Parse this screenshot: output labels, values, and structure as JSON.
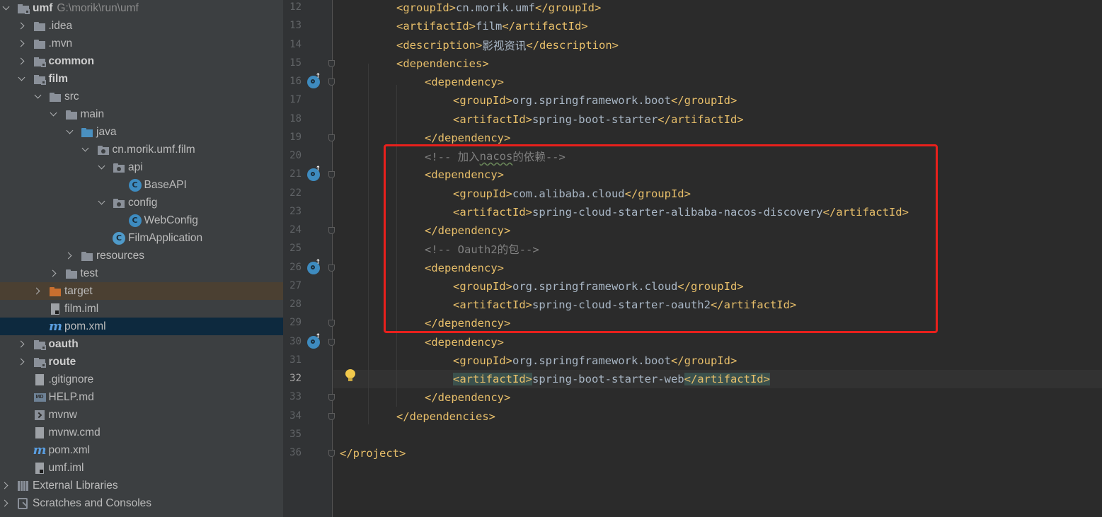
{
  "project_tree": {
    "items": [
      {
        "label": "umf",
        "path": "G:\\morik\\run\\umf",
        "depth": 0,
        "expanded": true,
        "icon": "module-folder-icon",
        "bold": true
      },
      {
        "label": ".idea",
        "depth": 1,
        "expanded": false,
        "icon": "folder-icon"
      },
      {
        "label": ".mvn",
        "depth": 1,
        "expanded": false,
        "icon": "folder-icon"
      },
      {
        "label": "common",
        "depth": 1,
        "expanded": false,
        "icon": "module-folder-icon",
        "bold": true
      },
      {
        "label": "film",
        "depth": 1,
        "expanded": true,
        "icon": "module-folder-icon",
        "bold": true
      },
      {
        "label": "src",
        "depth": 2,
        "expanded": true,
        "icon": "folder-icon"
      },
      {
        "label": "main",
        "depth": 3,
        "expanded": true,
        "icon": "folder-icon"
      },
      {
        "label": "java",
        "depth": 4,
        "expanded": true,
        "icon": "source-folder-icon"
      },
      {
        "label": "cn.morik.umf.film",
        "depth": 5,
        "expanded": true,
        "icon": "package-icon"
      },
      {
        "label": "api",
        "depth": 6,
        "expanded": true,
        "icon": "package-icon"
      },
      {
        "label": "BaseAPI",
        "depth": 7,
        "icon": "class-icon"
      },
      {
        "label": "config",
        "depth": 6,
        "expanded": true,
        "icon": "package-icon"
      },
      {
        "label": "WebConfig",
        "depth": 7,
        "icon": "class-icon"
      },
      {
        "label": "FilmApplication",
        "depth": 6,
        "icon": "spring-boot-class-icon"
      },
      {
        "label": "resources",
        "depth": 4,
        "expanded": false,
        "icon": "resources-folder-icon"
      },
      {
        "label": "test",
        "depth": 3,
        "expanded": false,
        "icon": "folder-icon"
      },
      {
        "label": "target",
        "depth": 2,
        "expanded": false,
        "icon": "excluded-folder-icon",
        "highlighted": true
      },
      {
        "label": "film.iml",
        "depth": 2,
        "icon": "iml-file-icon"
      },
      {
        "label": "pom.xml",
        "depth": 2,
        "icon": "maven-icon",
        "selected": true
      },
      {
        "label": "oauth",
        "depth": 1,
        "expanded": false,
        "icon": "module-folder-icon",
        "bold": true
      },
      {
        "label": "route",
        "depth": 1,
        "expanded": false,
        "icon": "module-folder-icon",
        "bold": true
      },
      {
        "label": ".gitignore",
        "depth": 1,
        "icon": "gitignore-file-icon"
      },
      {
        "label": "HELP.md",
        "depth": 1,
        "icon": "markdown-file-icon"
      },
      {
        "label": "mvnw",
        "depth": 1,
        "icon": "shell-script-icon"
      },
      {
        "label": "mvnw.cmd",
        "depth": 1,
        "icon": "text-file-icon"
      },
      {
        "label": "pom.xml",
        "depth": 1,
        "icon": "maven-icon"
      },
      {
        "label": "umf.iml",
        "depth": 1,
        "icon": "iml-file-icon"
      },
      {
        "label": "External Libraries",
        "depth": 0,
        "expanded": false,
        "icon": "libraries-icon"
      },
      {
        "label": "Scratches and Consoles",
        "depth": 0,
        "expanded": false,
        "icon": "scratches-icon"
      }
    ]
  },
  "editor": {
    "current_line": 32,
    "lines": [
      {
        "n": 12,
        "tokens": [
          {
            "t": "tag",
            "v": "<groupId>"
          },
          {
            "t": "txt",
            "v": "cn.morik.umf"
          },
          {
            "t": "tag",
            "v": "</groupId>"
          }
        ],
        "indent": 2
      },
      {
        "n": 13,
        "tokens": [
          {
            "t": "tag",
            "v": "<artifactId>"
          },
          {
            "t": "txt",
            "v": "film"
          },
          {
            "t": "tag",
            "v": "</artifactId>"
          }
        ],
        "indent": 2
      },
      {
        "n": 14,
        "tokens": [
          {
            "t": "tag",
            "v": "<description>"
          },
          {
            "t": "txt",
            "v": "影视资讯"
          },
          {
            "t": "tag",
            "v": "</description>"
          }
        ],
        "indent": 2
      },
      {
        "n": 15,
        "tokens": [
          {
            "t": "tag",
            "v": "<dependencies>"
          }
        ],
        "indent": 2,
        "fold": true
      },
      {
        "n": 16,
        "tokens": [
          {
            "t": "tag",
            "v": "<dependency>"
          }
        ],
        "indent": 3,
        "fold": true,
        "badge": true
      },
      {
        "n": 17,
        "tokens": [
          {
            "t": "tag",
            "v": "<groupId>"
          },
          {
            "t": "txt",
            "v": "org.springframework.boot"
          },
          {
            "t": "tag",
            "v": "</groupId>"
          }
        ],
        "indent": 4
      },
      {
        "n": 18,
        "tokens": [
          {
            "t": "tag",
            "v": "<artifactId>"
          },
          {
            "t": "txt",
            "v": "spring-boot-starter"
          },
          {
            "t": "tag",
            "v": "</artifactId>"
          }
        ],
        "indent": 4
      },
      {
        "n": 19,
        "tokens": [
          {
            "t": "tag",
            "v": "</dependency>"
          }
        ],
        "indent": 3,
        "fold": true
      },
      {
        "n": 20,
        "tokens": [
          {
            "t": "cmt",
            "v": "<!-- 加入"
          },
          {
            "t": "cmt ul",
            "v": "nacos"
          },
          {
            "t": "cmt",
            "v": "的依赖-->"
          }
        ],
        "indent": 3
      },
      {
        "n": 21,
        "tokens": [
          {
            "t": "tag",
            "v": "<dependency>"
          }
        ],
        "indent": 3,
        "fold": true,
        "badge": true
      },
      {
        "n": 22,
        "tokens": [
          {
            "t": "tag",
            "v": "<groupId>"
          },
          {
            "t": "txt",
            "v": "com.alibaba.cloud"
          },
          {
            "t": "tag",
            "v": "</groupId>"
          }
        ],
        "indent": 4
      },
      {
        "n": 23,
        "tokens": [
          {
            "t": "tag",
            "v": "<artifactId>"
          },
          {
            "t": "txt",
            "v": "spring-cloud-starter-alibaba-nacos-discovery"
          },
          {
            "t": "tag",
            "v": "</artifactId>"
          }
        ],
        "indent": 4
      },
      {
        "n": 24,
        "tokens": [
          {
            "t": "tag",
            "v": "</dependency>"
          }
        ],
        "indent": 3,
        "fold": true
      },
      {
        "n": 25,
        "tokens": [
          {
            "t": "cmt",
            "v": "<!-- Oauth2的包-->"
          }
        ],
        "indent": 3
      },
      {
        "n": 26,
        "tokens": [
          {
            "t": "tag",
            "v": "<dependency>"
          }
        ],
        "indent": 3,
        "fold": true,
        "badge": true
      },
      {
        "n": 27,
        "tokens": [
          {
            "t": "tag",
            "v": "<groupId>"
          },
          {
            "t": "txt",
            "v": "org.springframework.cloud"
          },
          {
            "t": "tag",
            "v": "</groupId>"
          }
        ],
        "indent": 4
      },
      {
        "n": 28,
        "tokens": [
          {
            "t": "tag",
            "v": "<artifactId>"
          },
          {
            "t": "txt",
            "v": "spring-cloud-starter-oauth2"
          },
          {
            "t": "tag",
            "v": "</artifactId>"
          }
        ],
        "indent": 4
      },
      {
        "n": 29,
        "tokens": [
          {
            "t": "tag",
            "v": "</dependency>"
          }
        ],
        "indent": 3,
        "fold": true
      },
      {
        "n": 30,
        "tokens": [
          {
            "t": "tag",
            "v": "<dependency>"
          }
        ],
        "indent": 3,
        "fold": true,
        "badge": true
      },
      {
        "n": 31,
        "tokens": [
          {
            "t": "tag",
            "v": "<groupId>"
          },
          {
            "t": "txt",
            "v": "org.springframework.boot"
          },
          {
            "t": "tag",
            "v": "</groupId>"
          }
        ],
        "indent": 4
      },
      {
        "n": 32,
        "tokens": [
          {
            "t": "tag match",
            "v": "<artifactId>"
          },
          {
            "t": "txt",
            "v": "spring-boot-starter-web"
          },
          {
            "t": "tag match",
            "v": "</artifactId>"
          }
        ],
        "indent": 4,
        "bulb": true
      },
      {
        "n": 33,
        "tokens": [
          {
            "t": "tag",
            "v": "</dependency>"
          }
        ],
        "indent": 3,
        "fold": true
      },
      {
        "n": 34,
        "tokens": [
          {
            "t": "tag",
            "v": "</dependencies>"
          }
        ],
        "indent": 2,
        "fold": true
      },
      {
        "n": 35,
        "tokens": [],
        "indent": 0
      },
      {
        "n": 36,
        "tokens": [
          {
            "t": "tag",
            "v": "</project>"
          }
        ],
        "indent": 0,
        "fold": true
      }
    ]
  },
  "colors": {
    "tree_bg": "#3c3f41",
    "editor_bg": "#2b2b2b",
    "xml_tag": "#e8bf6a",
    "comment": "#808080",
    "selection": "#0d293e",
    "annotation_box": "#e8201c"
  }
}
